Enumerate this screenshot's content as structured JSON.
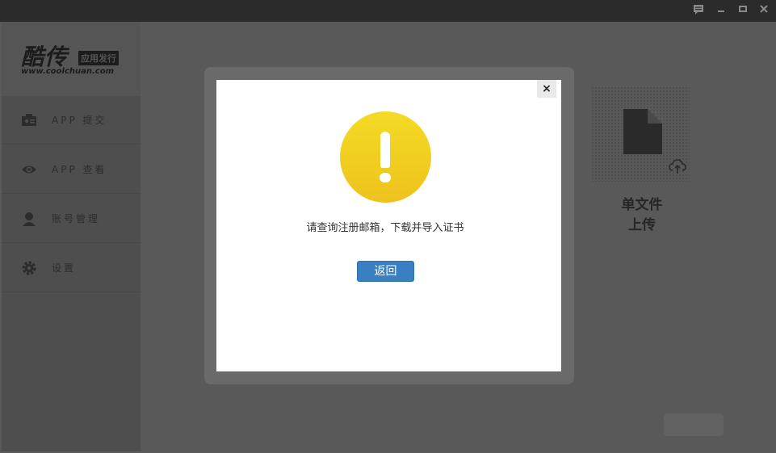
{
  "window": {
    "controls": [
      "feedback-icon",
      "minimize-icon",
      "maximize-icon",
      "close-icon"
    ]
  },
  "brand": {
    "name": "酷传",
    "tagline": "应用发行",
    "url": "www.coolchuan.com"
  },
  "sidebar": {
    "items": [
      {
        "label": "APP 提交",
        "icon": "id-card-icon"
      },
      {
        "label": "APP 查看",
        "icon": "eye-icon"
      },
      {
        "label": "账号管理",
        "icon": "user-icon"
      },
      {
        "label": "设置",
        "icon": "gear-icon"
      }
    ]
  },
  "upload": {
    "title_line1": "单文件",
    "title_line2": "上传",
    "icons": [
      "file-icon",
      "cloud-upload-icon"
    ]
  },
  "dialog": {
    "icon": "warning-icon",
    "close_label": "×",
    "message": "请查询注册邮箱，下载并导入证书",
    "button_label": "返回",
    "accent_color": "#3a7fc1",
    "warning_color": "#f0cc20"
  }
}
